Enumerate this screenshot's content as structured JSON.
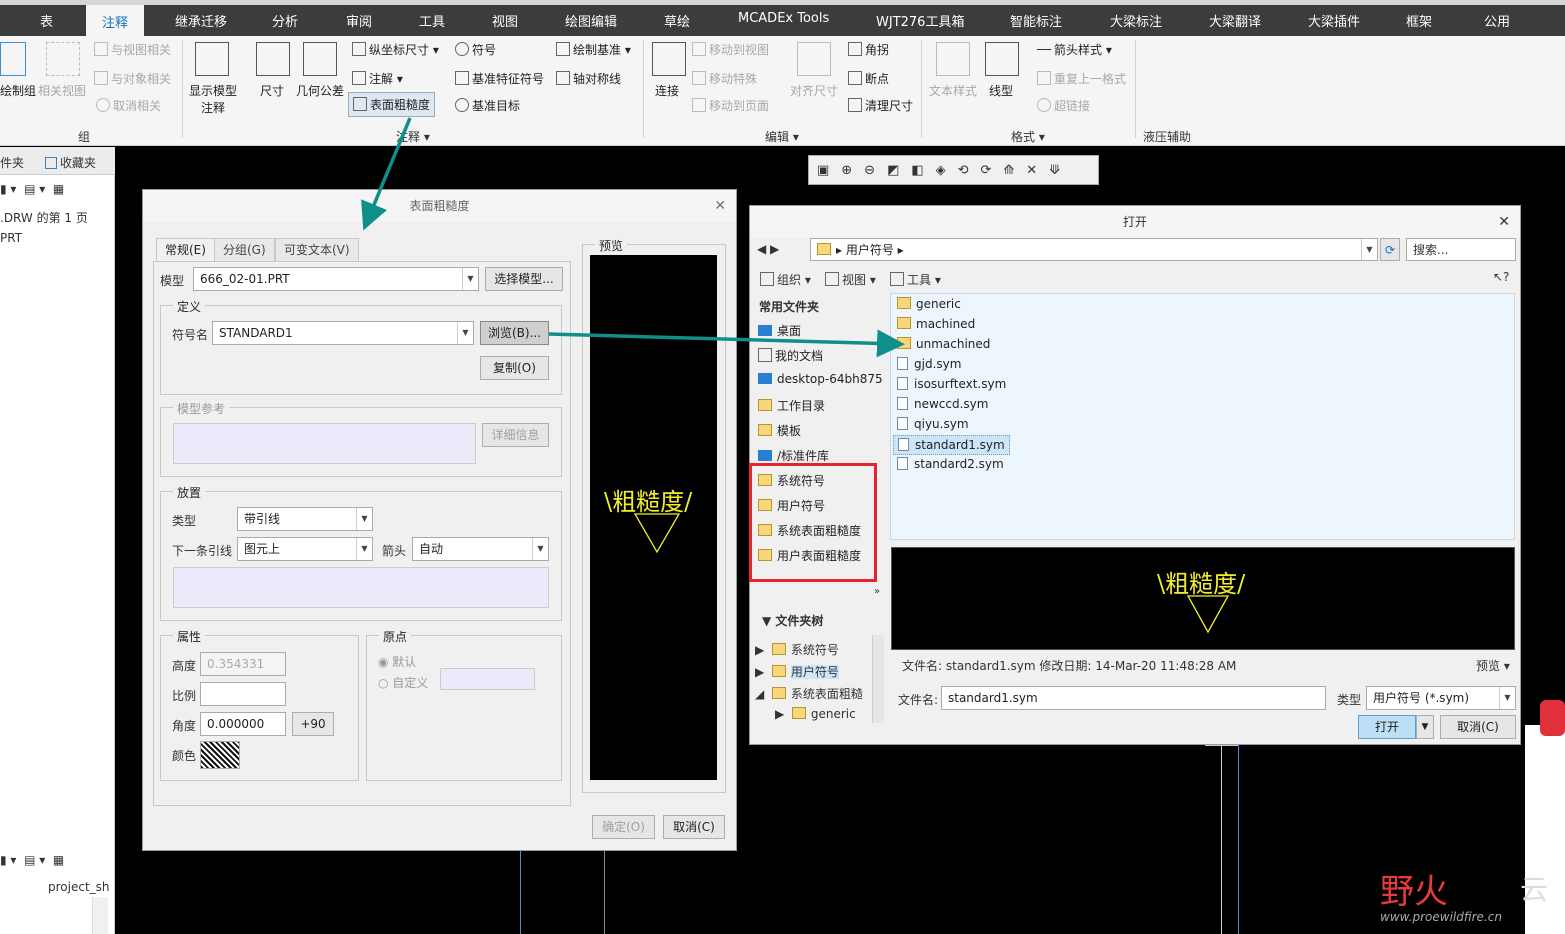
{
  "ribbon": {
    "tabs": [
      "表",
      "注释",
      "继承迁移",
      "分析",
      "审阅",
      "工具",
      "视图",
      "绘图编辑",
      "草绘",
      "MCADEx Tools",
      "WJT276工具箱",
      "智能标注",
      "大梁标注",
      "大梁翻译",
      "大梁插件",
      "框架",
      "公用"
    ],
    "active_tab": "注释",
    "cmd_group_draw": "绘制组",
    "cmd_related_view": "相关视图",
    "cmd_view_related": "与视图相关",
    "cmd_object_related": "与对象相关",
    "cmd_cancel_related": "取消相关",
    "cmd_show_model_annot_1": "显示模型",
    "cmd_show_model_annot_2": "注释",
    "cmd_dimension": "尺寸",
    "cmd_gtol": "几何公差",
    "cmd_ordinate_dim": "纵坐标尺寸",
    "cmd_note": "注解",
    "cmd_surface_finish": "表面粗糙度",
    "cmd_symbol": "符号",
    "cmd_datum_feature_symbol": "基准特征符号",
    "cmd_datum_target": "基准目标",
    "cmd_draw_datum": "绘制基准",
    "cmd_axis_symmetry": "轴对称线",
    "cmd_connect": "连接",
    "cmd_move_to_view": "移动到视图",
    "cmd_move_special": "移动特殊",
    "cmd_move_to_page": "移动到页面",
    "cmd_align_dim": "对齐尺寸",
    "cmd_corner": "角拐",
    "cmd_breakpoint": "断点",
    "cmd_cleanup_dim": "清理尺寸",
    "cmd_text_style": "文本样式",
    "cmd_line_style": "线型",
    "cmd_arrow_style": "箭头样式",
    "cmd_repeat_format": "重复上一格式",
    "cmd_hyperlink": "超链接",
    "group_group": "组",
    "group_annotation": "注释",
    "group_edit": "编辑",
    "group_format": "格式",
    "group_hydraulic": "液压辅助"
  },
  "left_panel": {
    "tab_folder": "件夹",
    "tab_favorites": "收藏夹",
    "item1": ".DRW 的第 1 页",
    "item2": "PRT",
    "bottom_item": "project_sh"
  },
  "sf_dialog": {
    "title": "表面粗糙度",
    "tabs": [
      "常规(E)",
      "分组(G)",
      "可变文本(V)"
    ],
    "model_label": "模型",
    "model_value": "666_02-01.PRT",
    "select_model_btn": "选择模型...",
    "definition_label": "定义",
    "symbol_name_label": "符号名",
    "symbol_name_value": "STANDARD1",
    "browse_btn": "浏览(B)...",
    "copy_btn": "复制(O)",
    "model_ref_label": "模型参考",
    "details_btn": "详细信息",
    "placement_label": "放置",
    "type_label": "类型",
    "type_value": "带引线",
    "next_leader_label": "下一条引线",
    "next_leader_value": "图元上",
    "arrow_label": "箭头",
    "arrow_value": "自动",
    "properties_label": "属性",
    "height_label": "高度",
    "height_value": "0.354331",
    "scale_label": "比例",
    "angle_label": "角度",
    "angle_value": "0.000000",
    "plus90_btn": "+90",
    "color_label": "颜色",
    "origin_label": "原点",
    "default_radio": "默认",
    "custom_radio": "自定义",
    "preview_label": "预览",
    "preview_text": "\\粗糙度/",
    "ok_btn": "确定(O)",
    "cancel_btn": "取消(C)"
  },
  "open_dialog": {
    "title": "打开",
    "path_segment": "用户符号",
    "search_placeholder": "搜索...",
    "organize_menu": "组织",
    "view_menu": "视图",
    "tools_menu": "工具",
    "common_folders_label": "常用文件夹",
    "nav_items": [
      "桌面",
      "我的文档",
      "desktop-64bh875",
      "工作目录",
      "模板",
      "/标准件库",
      "系统符号",
      "用户符号",
      "系统表面粗糙度",
      "用户表面粗糙度"
    ],
    "folder_tree_label": "文件夹树",
    "tree_items": [
      "系统符号",
      "用户符号",
      "系统表面粗糙",
      "generic"
    ],
    "files": [
      {
        "name": "generic",
        "kind": "folder"
      },
      {
        "name": "machined",
        "kind": "folder"
      },
      {
        "name": "unmachined",
        "kind": "folder"
      },
      {
        "name": "gjd.sym",
        "kind": "sym"
      },
      {
        "name": "isosurftext.sym",
        "kind": "sym"
      },
      {
        "name": "newccd.sym",
        "kind": "sym"
      },
      {
        "name": "qiyu.sym",
        "kind": "sym"
      },
      {
        "name": "standard1.sym",
        "kind": "sym",
        "selected": true
      },
      {
        "name": "standard2.sym",
        "kind": "sym"
      }
    ],
    "preview_text": "\\粗糙度/",
    "file_info": "文件名: standard1.sym   修改日期: 14-Mar-20 11:48:28 AM",
    "preview_toggle": "预览",
    "filename_label": "文件名:",
    "filename_value": "standard1.sym",
    "type_label": "类型",
    "type_value": "用户符号 (*.sym)",
    "open_btn": "打开",
    "cancel_btn": "取消(C)"
  },
  "watermark": {
    "brand": "野火",
    "url": "www.proewildfire.cn"
  },
  "colors": {
    "accent": "#1a6fbf",
    "annotation_arrow": "#0e8f8a",
    "highlight_box": "#e8232b",
    "symbol_yellow": "#f2ee2d"
  }
}
